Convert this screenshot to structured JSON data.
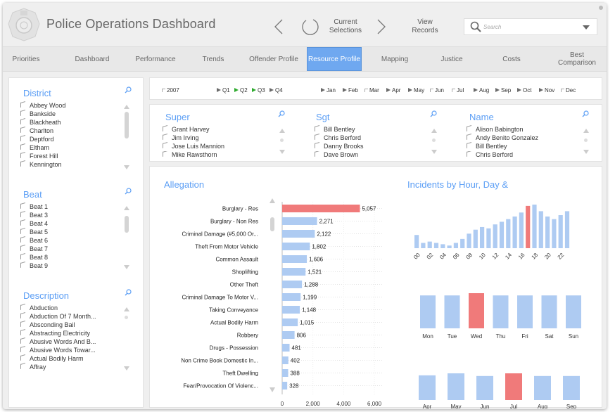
{
  "header": {
    "title": "Police Operations Dashboard",
    "current_selections": "Current Selections",
    "view_records": "View Records",
    "search_placeholder": "Search"
  },
  "tabs": [
    {
      "label": "Priorities",
      "active": false
    },
    {
      "label": "Dashboard",
      "active": false
    },
    {
      "label": "Performance",
      "active": false
    },
    {
      "label": "Trends",
      "active": false
    },
    {
      "label": "Offender Profile",
      "active": false
    },
    {
      "label": "Resource Profile",
      "active": true
    },
    {
      "label": "Mapping",
      "active": false
    },
    {
      "label": "Justice",
      "active": false
    },
    {
      "label": "Costs",
      "active": false
    },
    {
      "label": "Best Comparison",
      "active": false
    }
  ],
  "filters": {
    "year": "2007",
    "quarters": [
      {
        "label": "Q1",
        "selected": false
      },
      {
        "label": "Q2",
        "selected": true
      },
      {
        "label": "Q3",
        "selected": true
      },
      {
        "label": "Q4",
        "selected": false
      }
    ],
    "months": [
      {
        "label": "Jan",
        "state": "on"
      },
      {
        "label": "Feb",
        "state": "on"
      },
      {
        "label": "Mar",
        "state": "off"
      },
      {
        "label": "Apr",
        "state": "on"
      },
      {
        "label": "May",
        "state": "on"
      },
      {
        "label": "Jun",
        "state": "off"
      },
      {
        "label": "Jul",
        "state": "off"
      },
      {
        "label": "Aug",
        "state": "on"
      },
      {
        "label": "Sep",
        "state": "on"
      },
      {
        "label": "Oct",
        "state": "on"
      },
      {
        "label": "Nov",
        "state": "on"
      },
      {
        "label": "Dec",
        "state": "off"
      }
    ]
  },
  "district": {
    "title": "District",
    "items": [
      "Abbey Wood",
      "Bankside",
      "Blackheath",
      "Charlton",
      "Deptford",
      "Eltham",
      "Forest Hill",
      "Kennington"
    ]
  },
  "beat": {
    "title": "Beat",
    "items": [
      "Beat 1",
      "Beat 3",
      "Beat 4",
      "Beat 5",
      "Beat 6",
      "Beat 7",
      "Beat 8",
      "Beat 9"
    ]
  },
  "description": {
    "title": "Description",
    "items": [
      "Abduction",
      "Abduction Of 7 Month...",
      "Absconding Bail",
      "Abstracting Electricity",
      "Abusive Words And B...",
      "Abusive Words Towar...",
      "Actual Bodily Harm",
      "Affray"
    ]
  },
  "super": {
    "title": "Super",
    "items": [
      "Grant Harvey",
      "Jim Irving",
      "Jose Luis Mannion",
      "Mike Rawsthorn"
    ]
  },
  "sgt": {
    "title": "Sgt",
    "items": [
      "Bill Bentley",
      "Chris Berford",
      "Danny Brooks",
      "Dave Brown"
    ]
  },
  "name": {
    "title": "Name",
    "items": [
      "Alison Babington",
      "Andy Benito Gonzalez",
      "Bill Bentley",
      "Chris Berford"
    ]
  },
  "colors": {
    "bar": "#aecbf2",
    "highlight": "#f07a7a",
    "accent": "#5b9ef5",
    "active_tab": "#6fa8f0"
  },
  "allegation": {
    "title": "Allegation",
    "chart_data": {
      "type": "bar",
      "orientation": "horizontal",
      "categories": [
        "Burglary - Res",
        "Burglary - Non Res",
        "Criminal Damage (#5,000 Or...",
        "Theft From Motor Vehicle",
        "Common Assault",
        "Shoplifting",
        "Other Theft",
        "Criminal Damage To Motor V...",
        "Taking Conveyance",
        "Actual Bodily Harm",
        "Robbery",
        "Drugs - Possession",
        "Non Crime Book Domestic In...",
        "Theft Dwelling",
        "Fear/Provocation Of Violenc..."
      ],
      "values": [
        5057,
        2271,
        2122,
        1802,
        1606,
        1521,
        1288,
        1199,
        1148,
        1015,
        806,
        481,
        402,
        388,
        328
      ],
      "value_labels": [
        "5,057",
        "2,271",
        "2,122",
        "1,802",
        "1,606",
        "1,521",
        "1,288",
        "1,199",
        "1,148",
        "1,015",
        "806",
        "481",
        "402",
        "388",
        "328"
      ],
      "highlight_index": 0,
      "xticks": [
        "0",
        "2,000",
        "4,000",
        "6,000"
      ],
      "xtick_values": [
        0,
        2000,
        4000,
        6000
      ],
      "xlim": [
        0,
        6500
      ]
    }
  },
  "incidents": {
    "title": "Incidents by Hour, Day &",
    "hour_chart": {
      "type": "bar",
      "categories": [
        "00",
        "01",
        "02",
        "03",
        "04",
        "05",
        "06",
        "07",
        "08",
        "09",
        "10",
        "11",
        "12",
        "13",
        "14",
        "15",
        "16",
        "17",
        "18",
        "19",
        "20",
        "21",
        "22",
        "23"
      ],
      "tick_labels": [
        "00",
        "02",
        "04",
        "06",
        "08",
        "10",
        "12",
        "14",
        "16",
        "18",
        "20",
        "22"
      ],
      "values": [
        10,
        4,
        5,
        4,
        3,
        2,
        4,
        7,
        11,
        14,
        16,
        15,
        18,
        20,
        22,
        24,
        27,
        32,
        33,
        28,
        24,
        22,
        25,
        28
      ],
      "highlight_index": 17
    },
    "day_chart": {
      "type": "bar",
      "categories": [
        "Mon",
        "Tue",
        "Wed",
        "Thu",
        "Fri",
        "Sat",
        "Sun"
      ],
      "values": [
        44,
        44,
        47,
        44,
        44,
        44,
        44
      ],
      "highlight_index": 2
    },
    "month_chart": {
      "type": "bar",
      "categories": [
        "Apr",
        "May",
        "Jun",
        "Jul",
        "Aug",
        "Sep"
      ],
      "values": [
        37,
        40,
        36,
        40,
        36,
        36
      ],
      "highlight_index": 3
    }
  }
}
